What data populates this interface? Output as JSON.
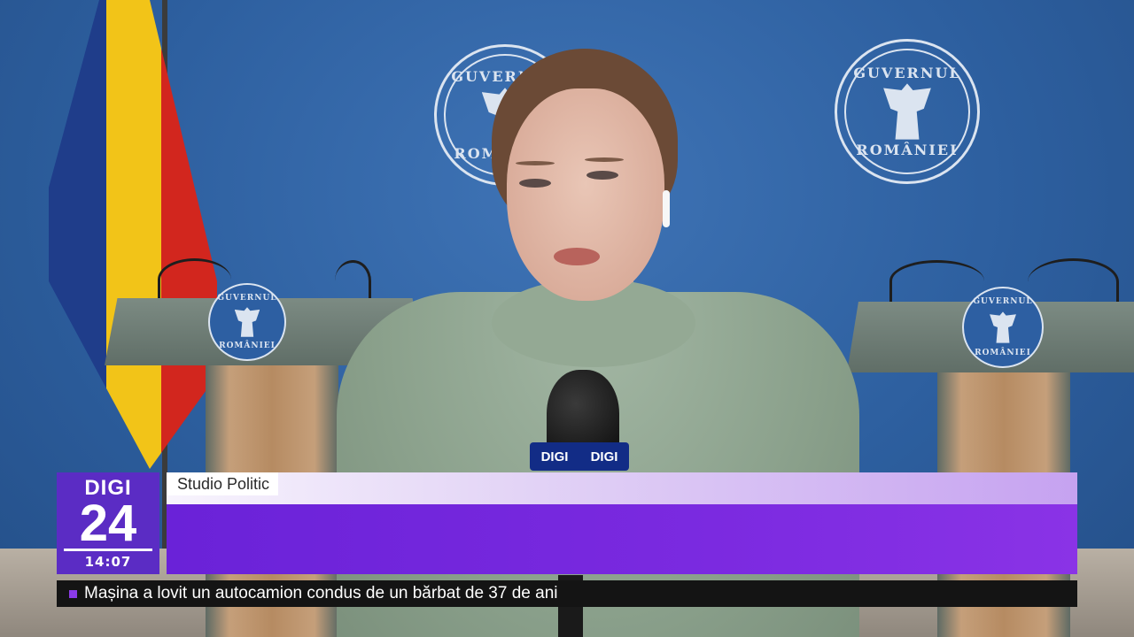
{
  "broadcast": {
    "channel_logo_top": "DIGI",
    "channel_logo_number": "24",
    "clock": "14:07",
    "show_name": "Studio Politic",
    "ticker_headline": "Mașina a lovit un autocamion condus de un bărbat de 37 de ani",
    "accent_color": "#7b2ae0"
  },
  "scene": {
    "seal_text_top": "GUVERNUL",
    "seal_text_bottom": "ROMÂNIEI",
    "mic_flag_label": "DIGI"
  }
}
